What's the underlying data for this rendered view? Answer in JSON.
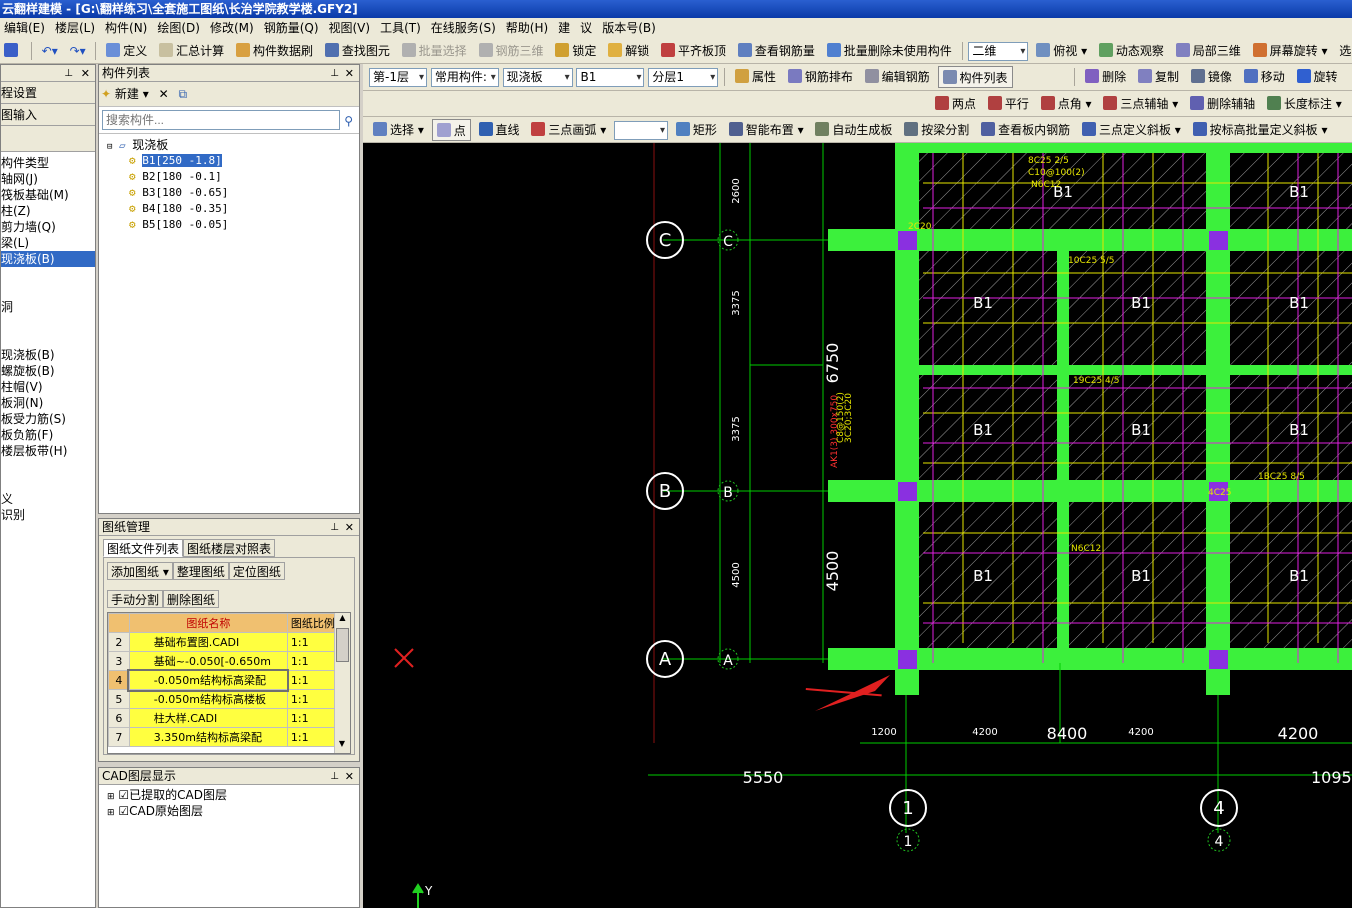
{
  "window": {
    "title": "云翻样建模 - [G:\\翻样练习\\全套施工图纸\\长治学院教学楼.GFY2]"
  },
  "menu": [
    "编辑(E)",
    "楼层(L)",
    "构件(N)",
    "绘图(D)",
    "修改(M)",
    "钢筋量(Q)",
    "视图(V)",
    "工具(T)",
    "在线服务(S)",
    "帮助(H)",
    "建",
    "议",
    "版本号(B)"
  ],
  "toolbar1": {
    "define": "定义",
    "sum_calc": "汇总计算",
    "comp_brush": "构件数据刷",
    "find_elem": "查找图元",
    "batch_select": "批量选择",
    "rebar_3d": "钢筋三维",
    "lock": "锁定",
    "unlock": "解锁",
    "flush_top": "平齐板顶",
    "view_rebar": "查看钢筋量",
    "batch_delete": "批量删除未使用构件",
    "view2d": "二维",
    "top_view": "俯视",
    "dynamic": "动态观察",
    "local3d": "局部三维",
    "screen_rotate": "屏幕旋转",
    "more": "选"
  },
  "toolbar2": {
    "floor": "第-1层",
    "comp_type": "常用构件:",
    "comp_cat": "现浇板",
    "comp_name": "B1",
    "layer": "分层1",
    "attr": "属性",
    "rebar_arrange": "钢筋排布",
    "edit_rebar": "编辑钢筋",
    "comp_list": "构件列表",
    "delete": "删除",
    "copy": "复制",
    "mirror": "镜像",
    "move": "移动",
    "rotate": "旋转"
  },
  "toolbar3": {
    "two_point": "两点",
    "parallel": "平行",
    "point_angle": "点角",
    "three_point_axis": "三点辅轴",
    "delete_axis": "删除辅轴",
    "length_mark": "长度标注"
  },
  "toolbar4": {
    "select": "选择",
    "point": "点",
    "line": "直线",
    "arc": "三点画弧",
    "rect": "矩形",
    "smart_place": "智能布置",
    "auto_gen": "自动生成板",
    "split_beam": "按梁分割",
    "view_inner_rebar": "查看板内钢筋",
    "three_point_slope": "三点定义斜板",
    "batch_slope": "按标高批量定义斜板"
  },
  "nav": {
    "title": "",
    "btn1": "程设置",
    "btn2": "图输入",
    "items": [
      "构件类型",
      "轴网(J)",
      "筏板基础(M)",
      "柱(Z)",
      "剪力墙(Q)",
      "梁(L)",
      "现浇板(B)",
      "",
      "",
      "洞",
      "",
      "",
      "现浇板(B)",
      "螺旋板(B)",
      "柱帽(V)",
      "板洞(N)",
      "板受力筋(S)",
      "板负筋(F)",
      "楼层板带(H)",
      "",
      "",
      "义",
      "识别"
    ]
  },
  "comp_panel": {
    "title": "构件列表",
    "new": "新建",
    "search_placeholder": "搜索构件...",
    "root": "现浇板",
    "items": [
      "B1[250 -1.8]",
      "B2[180 -0.1]",
      "B3[180 -0.65]",
      "B4[180 -0.35]",
      "B5[180 -0.05]"
    ]
  },
  "drawing_panel": {
    "title": "图纸管理",
    "tab1": "图纸文件列表",
    "tab2": "图纸楼层对照表",
    "add": "添加图纸",
    "arrange": "整理图纸",
    "locate": "定位图纸",
    "manual_split": "手动分割",
    "delete": "删除图纸",
    "col_name": "图纸名称",
    "col_scale": "图纸比例",
    "rows": [
      {
        "no": "2",
        "name": "基础布置图.CADI",
        "scale": "1:1"
      },
      {
        "no": "3",
        "name": "基础~-0.050[-0.650m",
        "scale": "1:1"
      },
      {
        "no": "4",
        "name": "-0.050m结构标高梁配",
        "scale": "1:1"
      },
      {
        "no": "5",
        "name": "-0.050m结构标高楼板",
        "scale": "1:1"
      },
      {
        "no": "6",
        "name": "柱大样.CADI",
        "scale": "1:1"
      },
      {
        "no": "7",
        "name": "3.350m结构标高梁配",
        "scale": "1:1"
      }
    ]
  },
  "cad_panel": {
    "title": "CAD图层显示",
    "layer1": "已提取的CAD图层",
    "layer2": "CAD原始图层"
  },
  "canvas": {
    "axis_rows": [
      "C",
      "B",
      "A"
    ],
    "axis_cols": [
      "1",
      "4"
    ],
    "dims_v": [
      "2600",
      "3375",
      "6750",
      "3375",
      "4500",
      "4500"
    ],
    "dims_h": [
      "1200",
      "4200",
      "8400",
      "4200",
      "4200",
      "5550",
      "1095"
    ],
    "slab_label": "B1",
    "beam_note": "AK1(3) 300x750",
    "y_axis": "Y",
    "annotations": [
      "8C25 2/5",
      "C10@100(2)",
      "N6C12",
      "10C25 5/5",
      "19C25 4/5",
      "C10@100(2)",
      "N6C12",
      "4C25",
      "2C20",
      "1BC25 8/5",
      "C8@150(2)",
      "3C20;3C20"
    ]
  }
}
